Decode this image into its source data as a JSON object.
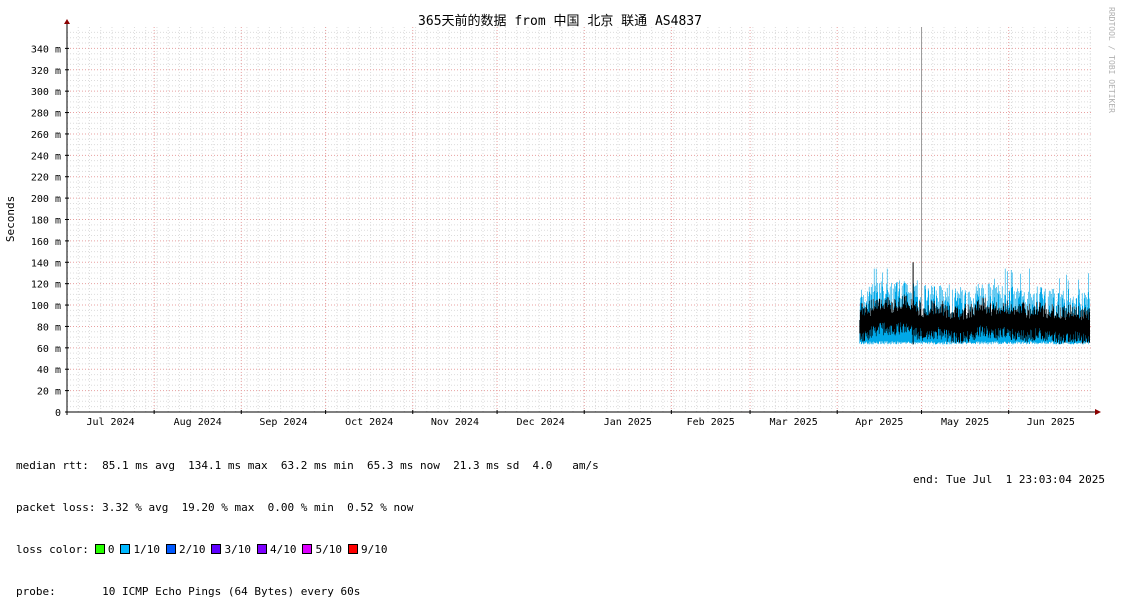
{
  "chart_data": {
    "type": "line",
    "title": "365天前的数据 from 中国 北京 联通 AS4837",
    "ylabel": "Seconds",
    "watermark": "RRDTOOL / TOBI OETIKER",
    "ylim": [
      0,
      360
    ],
    "yticks": [
      {
        "value": 0,
        "label": "0"
      },
      {
        "value": 20,
        "label": "20 m"
      },
      {
        "value": 40,
        "label": "40 m"
      },
      {
        "value": 60,
        "label": "60 m"
      },
      {
        "value": 80,
        "label": "80 m"
      },
      {
        "value": 100,
        "label": "100 m"
      },
      {
        "value": 120,
        "label": "120 m"
      },
      {
        "value": 140,
        "label": "140 m"
      },
      {
        "value": 160,
        "label": "160 m"
      },
      {
        "value": 180,
        "label": "180 m"
      },
      {
        "value": 200,
        "label": "200 m"
      },
      {
        "value": 220,
        "label": "220 m"
      },
      {
        "value": 240,
        "label": "240 m"
      },
      {
        "value": 260,
        "label": "260 m"
      },
      {
        "value": 280,
        "label": "280 m"
      },
      {
        "value": 300,
        "label": "300 m"
      },
      {
        "value": 320,
        "label": "320 m"
      },
      {
        "value": 340,
        "label": "340 m"
      }
    ],
    "xlim": [
      "2024-07-01",
      "2025-07-01"
    ],
    "month_starts": [
      "2024-07-01",
      "2024-08-01",
      "2024-09-01",
      "2024-10-01",
      "2024-11-01",
      "2024-12-01",
      "2025-01-01",
      "2025-02-01",
      "2025-03-01",
      "2025-04-01",
      "2025-05-01",
      "2025-06-01"
    ],
    "month_labels": [
      "Jul 2024",
      "Aug 2024",
      "Sep 2024",
      "Oct 2024",
      "Nov 2024",
      "Dec 2024",
      "Jan 2025",
      "Feb 2025",
      "Mar 2025",
      "Apr 2025",
      "May 2025",
      "Jun 2025"
    ],
    "grid": true,
    "series": [
      {
        "color": "#000000",
        "band_color": "#00a8e8",
        "data_start": "2025-04-09",
        "data_end": "2025-06-30",
        "median_ms_points": [
          [
            "2025-04-09",
            82
          ],
          [
            "2025-04-13",
            86
          ],
          [
            "2025-04-17",
            90
          ],
          [
            "2025-04-21",
            88
          ],
          [
            "2025-04-25",
            92
          ],
          [
            "2025-04-29",
            85
          ],
          [
            "2025-05-03",
            84
          ],
          [
            "2025-05-07",
            86
          ],
          [
            "2025-05-11",
            82
          ],
          [
            "2025-05-15",
            80
          ],
          [
            "2025-05-19",
            84
          ],
          [
            "2025-05-23",
            88
          ],
          [
            "2025-05-27",
            85
          ],
          [
            "2025-05-31",
            86
          ],
          [
            "2025-06-04",
            84
          ],
          [
            "2025-06-08",
            83
          ],
          [
            "2025-06-12",
            85
          ],
          [
            "2025-06-16",
            82
          ],
          [
            "2025-06-20",
            80
          ],
          [
            "2025-06-24",
            82
          ],
          [
            "2025-06-28",
            80
          ],
          [
            "2025-06-30",
            78
          ]
        ],
        "min_ms": 63.2,
        "max_ms": 134.1,
        "peak": {
          "date": "2025-04-28",
          "value_ms": 140
        },
        "spike": {
          "date": "2025-05-01",
          "value_ms": 360
        }
      }
    ]
  },
  "stats": {
    "median_rtt": "median rtt:  85.1 ms avg  134.1 ms max  63.2 ms min  65.3 ms now  21.3 ms sd  4.0   am/s",
    "packet_loss": "packet loss: 3.32 % avg  19.20 % max  0.00 % min  0.52 % now",
    "loss_color_label": "loss color:",
    "loss_colors": [
      {
        "label": "0",
        "color": "#26ff00"
      },
      {
        "label": "1/10",
        "color": "#00b8ff"
      },
      {
        "label": "2/10",
        "color": "#0059ff"
      },
      {
        "label": "3/10",
        "color": "#5e00ff"
      },
      {
        "label": "4/10",
        "color": "#7e00ff"
      },
      {
        "label": "5/10",
        "color": "#dd00ff"
      },
      {
        "label": "9/10",
        "color": "#ff0000"
      }
    ],
    "probe": "probe:       10 ICMP Echo Pings (64 Bytes) every 60s",
    "end": "end: Tue Jul  1 23:03:04 2025"
  }
}
